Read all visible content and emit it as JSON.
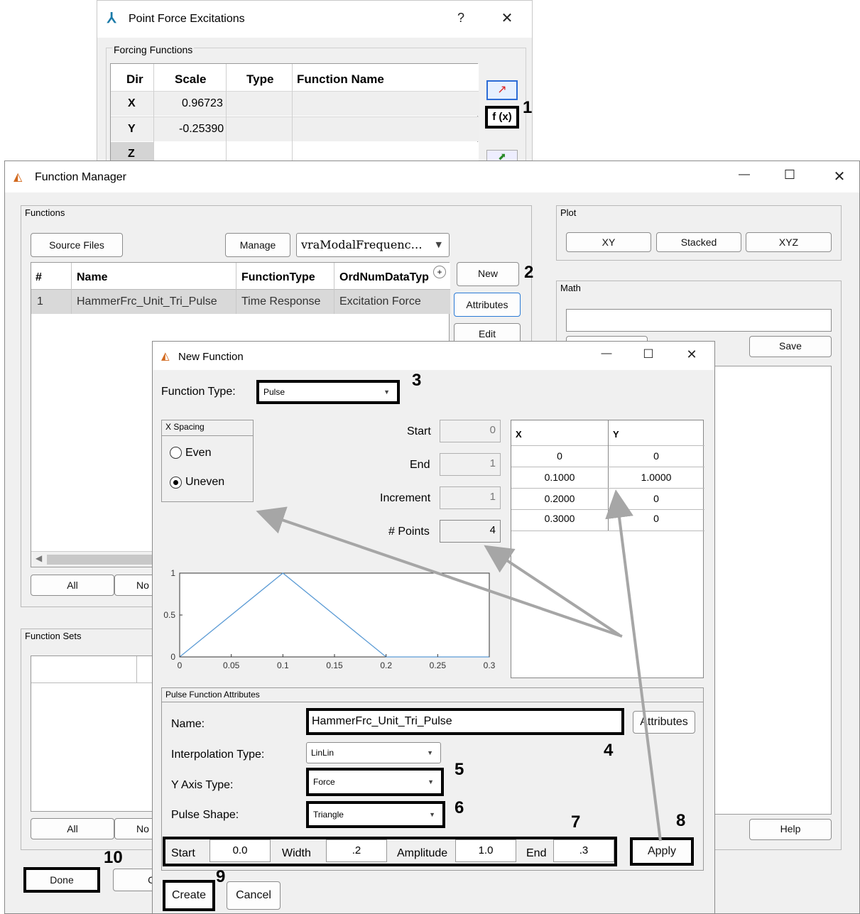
{
  "pfe": {
    "title": "Point Force Excitations",
    "help": "?",
    "close": "✕",
    "group_label": "Forcing Functions",
    "columns": [
      "Dir",
      "Scale",
      "Type",
      "Function Name"
    ],
    "rows": [
      {
        "dir": "X",
        "scale": "0.96723",
        "type": "",
        "fname": ""
      },
      {
        "dir": "Y",
        "scale": "-0.25390",
        "type": "",
        "fname": ""
      },
      {
        "dir": "Z",
        "scale": "",
        "type": "",
        "fname": ""
      }
    ],
    "fx_label": "f (x)"
  },
  "fm": {
    "title": "Function Manager",
    "minimize": "—",
    "maximize": "☐",
    "close": "✕",
    "functions_label": "Functions",
    "source_files": "Source Files",
    "manage": "Manage",
    "model_select": "vraModalFrequenc…",
    "columns": [
      "#",
      "Name",
      "FunctionType",
      "OrdNumDataTyp"
    ],
    "rows": [
      {
        "num": "1",
        "name": "HammerFrc_Unit_Tri_Pulse",
        "ftype": "Time Response",
        "ordnum": "Excitation Force"
      }
    ],
    "new_btn": "New",
    "attributes_btn": "Attributes",
    "edit_btn": "Edit",
    "all_btn": "All",
    "none_btn": "No",
    "function_sets_label": "Function Sets",
    "all_btn2": "All",
    "none_btn2": "No",
    "done_btn": "Done",
    "cancel_btn": "Ca",
    "plot_label": "Plot",
    "xy_btn": "XY",
    "stacked_btn": "Stacked",
    "xyz_btn": "XYZ",
    "math_label": "Math",
    "math_input": "",
    "save_btn": "Save",
    "help_btn": "Help"
  },
  "nf": {
    "title": "New Function",
    "minimize": "—",
    "maximize": "☐",
    "close": "✕",
    "function_type_label": "Function Type:",
    "function_type_value": "Pulse",
    "x_spacing_label": "X Spacing",
    "even": "Even",
    "uneven": "Uneven",
    "start_label": "Start",
    "start_value": "0",
    "end_label": "End",
    "end_value": "1",
    "increment_label": "Increment",
    "increment_value": "1",
    "points_label": "# Points",
    "points_value": "4",
    "xy_columns": [
      "X",
      "Y"
    ],
    "xy_rows": [
      {
        "x": "0",
        "y": "0"
      },
      {
        "x": "0.1000",
        "y": "1.0000"
      },
      {
        "x": "0.2000",
        "y": "0"
      },
      {
        "x": "0.3000",
        "y": "0"
      }
    ],
    "pulse_label": "Pulse Function Attributes",
    "name_label": "Name:",
    "name_value": "HammerFrc_Unit_Tri_Pulse",
    "attributes_btn": "Attributes",
    "interp_label": "Interpolation Type:",
    "interp_value": "LinLin",
    "yaxis_label": "Y Axis Type:",
    "yaxis_value": "Force",
    "shape_label": "Pulse Shape:",
    "shape_value": "Triangle",
    "start_lbl": "Start",
    "start_val": "0.0",
    "width_lbl": "Width",
    "width_val": ".2",
    "amp_lbl": "Amplitude",
    "amp_val": "1.0",
    "end_lbl": "End",
    "end_val": ".3",
    "apply_btn": "Apply",
    "create_btn": "Create",
    "cancel_btn": "Cancel"
  },
  "callouts": [
    "1",
    "2",
    "3",
    "4",
    "5",
    "6",
    "7",
    "8",
    "9",
    "10"
  ],
  "chart_data": {
    "type": "line",
    "x": [
      0,
      0.1,
      0.2,
      0.3
    ],
    "values": [
      0,
      1,
      0,
      0
    ],
    "xticks": [
      "0",
      "0.05",
      "0.1",
      "0.15",
      "0.2",
      "0.25",
      "0.3"
    ],
    "yticks": [
      "0",
      "0.5",
      "1"
    ],
    "xlim": [
      0,
      0.3
    ],
    "ylim": [
      0,
      1
    ],
    "color": "#5b9bd5"
  }
}
